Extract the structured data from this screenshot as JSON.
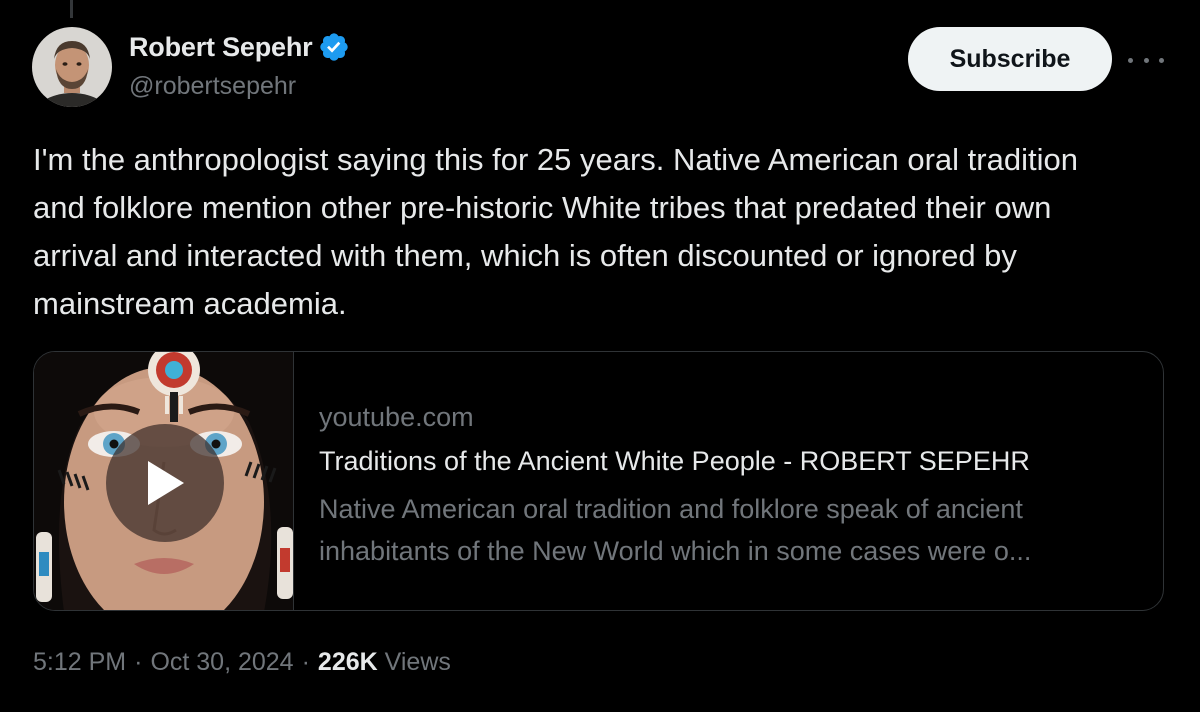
{
  "author": {
    "display_name": "Robert Sepehr",
    "handle": "@robertsepehr",
    "verified_icon": "verified-badge-icon"
  },
  "actions": {
    "subscribe_label": "Subscribe",
    "more_icon": "more-horizontal-icon"
  },
  "tweet": {
    "text": "I'm the anthropologist saying this for 25 years. Native American oral tradition and folklore mention other pre-historic White tribes that predated their own arrival and interacted with them, which is often discounted or ignored by mainstream academia."
  },
  "card": {
    "domain": "youtube.com",
    "title": "Traditions of the Ancient White People - ROBERT SEPEHR",
    "description": "Native American oral tradition and folklore speak of ancient inhabitants of the New World which in some cases were o...",
    "play_icon": "play-icon"
  },
  "meta": {
    "time": "5:12 PM",
    "separator1": "·",
    "date": "Oct 30, 2024",
    "separator2": "·",
    "views_count": "226K",
    "views_label": "Views"
  },
  "colors": {
    "background": "#000000",
    "text_primary": "#e7e9ea",
    "text_secondary": "#71767b",
    "verified_blue": "#1d9bf0",
    "border": "#2f3336"
  }
}
